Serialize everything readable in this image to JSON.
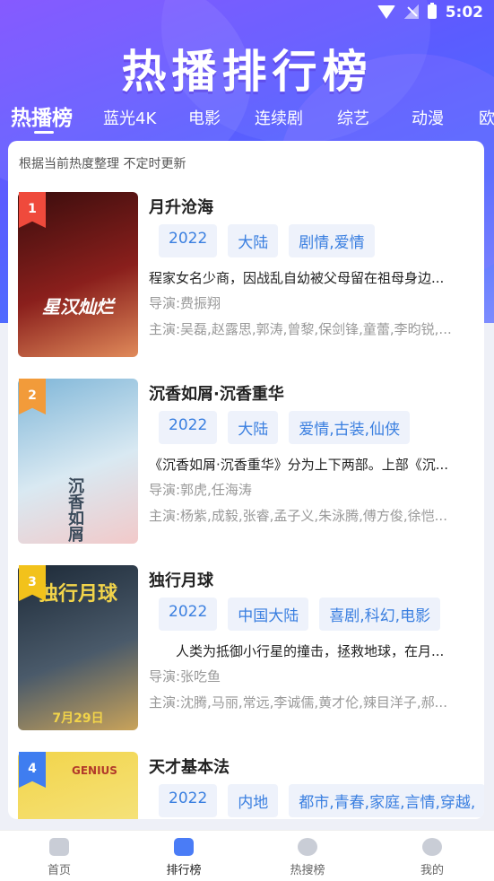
{
  "status_bar": {
    "time": "5:02"
  },
  "header": {
    "title": "热播排行榜"
  },
  "tabs": [
    {
      "label": "热播榜",
      "active": true
    },
    {
      "label": "蓝光4K"
    },
    {
      "label": "电影"
    },
    {
      "label": "连续剧"
    },
    {
      "label": "综艺"
    },
    {
      "label": "动漫"
    },
    {
      "label": "欧"
    }
  ],
  "subtitle": "根据当前热度整理 不定时更新",
  "items": [
    {
      "rank": "1",
      "rank_color": "#ef4a3c",
      "name": "月升沧海",
      "tags": [
        "2022",
        "大陆",
        "剧情,爱情"
      ],
      "description": "程家女名少商，因战乱自幼被父母留在祖母身边...",
      "director": "导演:费振翔",
      "cast": "主演:吴磊,赵露思,郭涛,曾黎,保剑锋,童蕾,李昀锐,...",
      "poster_text": "星汉灿烂",
      "poster_colors": [
        "#3a0d0d",
        "#8a1f1c",
        "#e08a5a"
      ]
    },
    {
      "rank": "2",
      "rank_color": "#f29b3a",
      "name": "沉香如屑·沉香重华",
      "tags": [
        "2022",
        "大陆",
        "爱情,古装,仙侠"
      ],
      "description": "《沉香如屑·沉香重华》分为上下两部。上部《沉...",
      "director": "导演:郭虎,任海涛",
      "cast": "主演:杨紫,成毅,张睿,孟子义,朱泳腾,傅方俊,徐恺...",
      "poster_text": "沉香如屑",
      "poster_colors": [
        "#7fb6d8",
        "#d9e9f2",
        "#f2c9c9"
      ]
    },
    {
      "rank": "3",
      "rank_color": "#f2c21b",
      "name": "独行月球",
      "tags": [
        "2022",
        "中国大陆",
        "喜剧,科幻,电影"
      ],
      "description": "　　人类为抵御小行星的撞击，拯救地球，在月...",
      "director": "导演:张吃鱼",
      "cast": "主演:沈腾,马丽,常远,李诚儒,黄才伦,辣目洋子,郝...",
      "poster_text": "独行月球",
      "poster_date": "7月29日",
      "poster_colors": [
        "#1d2a38",
        "#4a5a6a",
        "#c9a35a"
      ]
    },
    {
      "rank": "4",
      "rank_color": "#3f7df0",
      "name": "天才基本法",
      "tags": [
        "2022",
        "内地",
        "都市,青春,家庭,言情,穿越,"
      ],
      "description": "",
      "director": "",
      "cast": "",
      "poster_text": "GENIUS",
      "poster_colors": [
        "#f2d44a",
        "#f5e27a",
        "#e9c23a"
      ]
    }
  ],
  "bottom_nav": [
    {
      "label": "首页",
      "icon": "home-icon"
    },
    {
      "label": "排行榜",
      "icon": "crown-icon",
      "active": true
    },
    {
      "label": "热搜榜",
      "icon": "compass-icon"
    },
    {
      "label": "我的",
      "icon": "profile-icon"
    }
  ]
}
